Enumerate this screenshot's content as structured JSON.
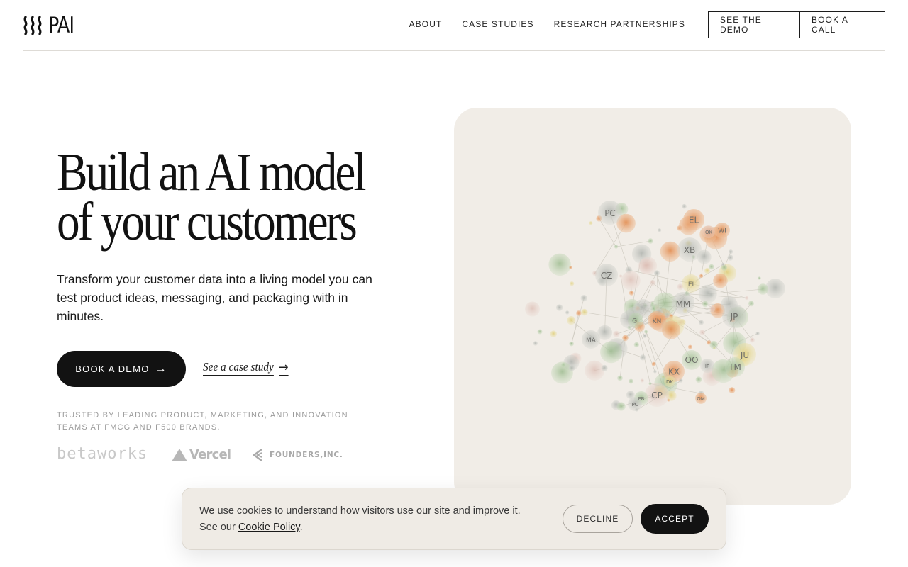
{
  "header": {
    "logo_text": "PAI",
    "nav": [
      {
        "label": "ABOUT"
      },
      {
        "label": "CASE STUDIES"
      },
      {
        "label": "RESEARCH PARTNERSHIPS"
      }
    ],
    "see_demo": "SEE THE DEMO",
    "book_call": "BOOK A CALL"
  },
  "hero": {
    "title_line1": "Build an AI model",
    "title_line2": "of your customers",
    "subtitle": "Transform your customer data into a living model you can test product ideas, messaging, and packaging with in minutes.",
    "primary_cta": "BOOK A DEMO",
    "primary_cta_arrow": "→",
    "secondary_cta": "See a case study",
    "secondary_cta_arrow": "→",
    "trusted_text": "TRUSTED BY LEADING PRODUCT, MARKETING, AND INNOVATION TEAMS AT FMCG AND F500 BRANDS.",
    "partner_logos": [
      {
        "name": "betaworks"
      },
      {
        "name": "Vercel"
      },
      {
        "name": "FOUNDERS,INC."
      }
    ]
  },
  "visualization": {
    "node_labels": [
      "PC",
      "EL",
      "OK",
      "WI",
      "XB",
      "CZ",
      "EI",
      "MM",
      "JP",
      "GI",
      "KN",
      "MA",
      "OO",
      "JU",
      "TM",
      "KX",
      "CP",
      "IP",
      "FB",
      "DK",
      "OM",
      "PC"
    ],
    "palette": {
      "orange": "#e9a06a",
      "green": "#a8c49a",
      "gray": "#b9bbb4",
      "yellow": "#e2d48a",
      "card_bg": "#f1ede7"
    }
  },
  "cookie": {
    "text_main": "We use cookies to understand how visitors use our site and improve it.",
    "text_prefix": "See our ",
    "policy_link": "Cookie Policy",
    "text_suffix": ".",
    "decline": "DECLINE",
    "accept": "ACCEPT"
  },
  "colors": {
    "text": "#141414",
    "button_dark": "#121212",
    "muted": "#9a9a9a",
    "card_bg": "#f1ede7"
  }
}
